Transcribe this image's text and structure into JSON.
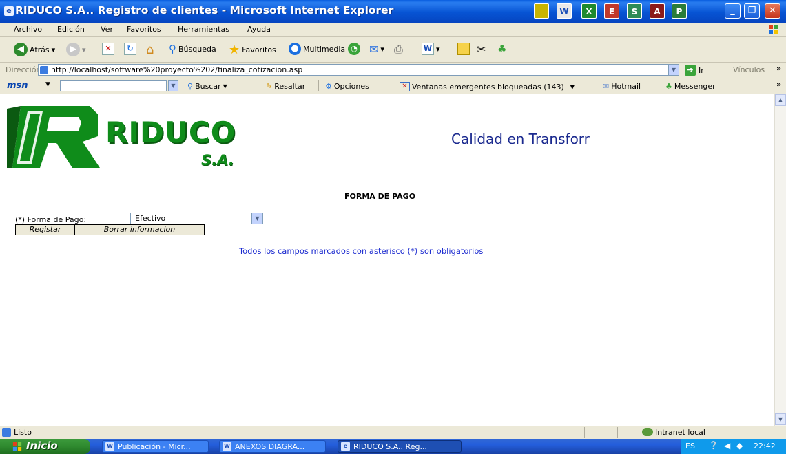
{
  "window": {
    "title": "RIDUCO S.A.. Registro de clientes - Microsoft Internet Explorer",
    "app_icons": [
      "W",
      "X",
      "E",
      "S",
      "A",
      "P"
    ]
  },
  "menu": [
    "Archivo",
    "Edición",
    "Ver",
    "Favoritos",
    "Herramientas",
    "Ayuda"
  ],
  "toolbar": {
    "back": "Atrás",
    "search": "Búsqueda",
    "favorites": "Favoritos",
    "media": "Multimedia"
  },
  "address": {
    "label": "Dirección",
    "url": "http://localhost/software%20proyecto%202/finaliza_cotizacion.asp",
    "go": "Ir",
    "links": "Vínculos"
  },
  "msn": {
    "logo": "msn",
    "search": "Buscar",
    "highlight": "Resaltar",
    "options": "Opciones",
    "popups": "Ventanas emergentes bloqueadas (143)",
    "hotmail": "Hotmail",
    "messenger": "Messenger"
  },
  "page": {
    "logo_text": "RIDUCO",
    "logo_sub": "S.A.",
    "marquee": "Calidad en Transforr",
    "form_title": "FORMA DE PAGO",
    "pay_label": "(*) Forma de Pago:",
    "pay_value": "Efectivo",
    "register_button": "Registar",
    "clear_button": "Borrar informacion",
    "note": "Todos los campos marcados con asterisco (*) son obligatorios"
  },
  "status": {
    "text": "Listo",
    "zone": "Intranet local"
  },
  "taskbar": {
    "start": "Inicio",
    "tasks": [
      "Publicación - Micr...",
      "ANEXOS DIAGRA...",
      "RIDUCO S.A.. Reg..."
    ],
    "lang": "ES",
    "clock": "22:42"
  },
  "colors": {
    "logo_green": "#0f8c1a",
    "link_blue": "#1b2acf",
    "titlebar_blue": "#0754d4"
  }
}
